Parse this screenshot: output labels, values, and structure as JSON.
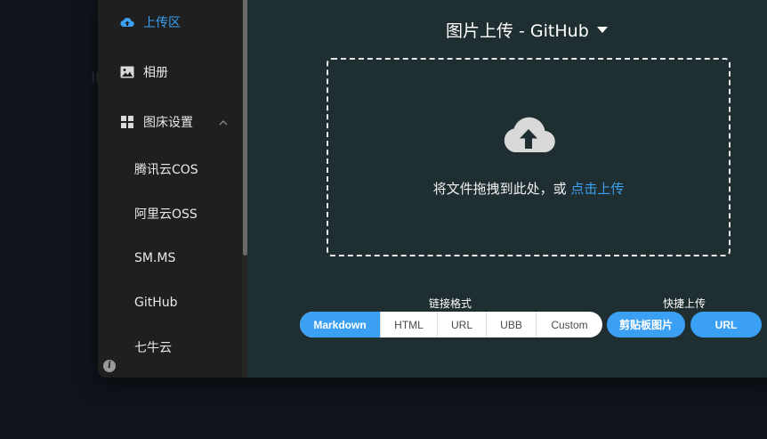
{
  "background_ghost_text": "It",
  "sidebar": {
    "items": [
      {
        "label": "上传区",
        "icon": "cloud-upload-icon",
        "active": true
      },
      {
        "label": "相册",
        "icon": "image-icon",
        "active": false
      },
      {
        "label": "图床设置",
        "icon": "grid-icon",
        "active": false,
        "expanded": true
      }
    ],
    "sub_items": [
      {
        "label": "腾讯云COS"
      },
      {
        "label": "阿里云OSS"
      },
      {
        "label": "SM.MS"
      },
      {
        "label": "GitHub"
      },
      {
        "label": "七牛云"
      }
    ],
    "info_icon": "info-icon"
  },
  "main": {
    "title": "图片上传 - GitHub",
    "dropzone": {
      "icon": "cloud-upload-icon",
      "text": "将文件拖拽到此处，或 ",
      "link": "点击上传"
    },
    "link_format": {
      "label": "链接格式",
      "options": [
        "Markdown",
        "HTML",
        "URL",
        "UBB",
        "Custom"
      ],
      "selected": "Markdown"
    },
    "quick_upload": {
      "label": "快捷上传",
      "buttons": [
        "剪贴板图片",
        "URL"
      ]
    }
  },
  "colors": {
    "accent": "#3ba0f4",
    "sidebar_bg": "#1f1f1f",
    "main_bg": "#1f2e30",
    "page_bg": "#0f141b"
  }
}
